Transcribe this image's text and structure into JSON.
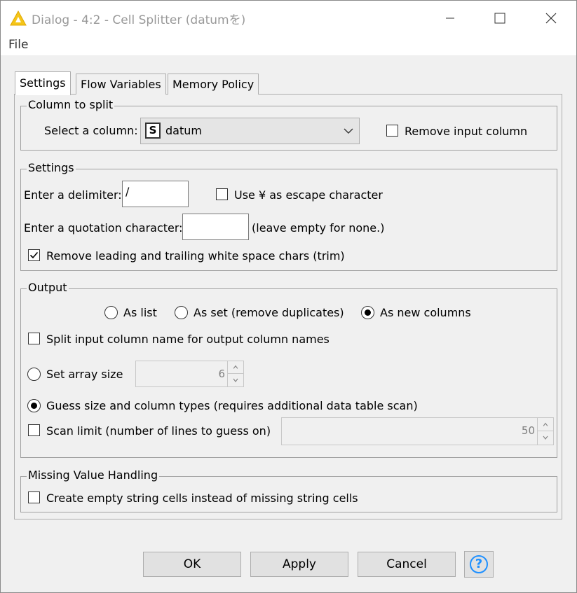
{
  "window": {
    "title": "Dialog - 4:2 - Cell Splitter (datumを)",
    "menu_file": "File"
  },
  "tabs": [
    "Settings",
    "Flow Variables",
    "Memory Policy"
  ],
  "column_group": {
    "title": "Column to split",
    "select_label": "Select a column:",
    "selected_type_icon": "S",
    "selected_column": "datum",
    "remove_input_label": "Remove input column",
    "remove_input_checked": false
  },
  "settings_group": {
    "title": "Settings",
    "delimiter_label": "Enter a delimiter:",
    "delimiter_value": "/",
    "escape_label": "Use ¥ as escape character",
    "escape_checked": false,
    "quote_label": "Enter a quotation character:",
    "quote_value": "",
    "quote_hint": "(leave empty for none.)",
    "trim_label": "Remove leading and trailing white space chars (trim)",
    "trim_checked": true
  },
  "output_group": {
    "title": "Output",
    "as_list_label": "As list",
    "as_set_label": "As set (remove duplicates)",
    "as_columns_label": "As new columns",
    "selected_output": "As new columns",
    "split_names_label": "Split input column name for output column names",
    "split_names_checked": false,
    "array_size_label": "Set array size",
    "array_size_value": "6",
    "guess_label": "Guess size and column types (requires additional data table scan)",
    "guess_selected": true,
    "scan_limit_label": "Scan limit (number of lines to guess on)",
    "scan_limit_checked": false,
    "scan_limit_value": "50"
  },
  "missing_group": {
    "title": "Missing Value Handling",
    "empty_string_label": "Create empty string cells instead of missing string cells",
    "empty_string_checked": false
  },
  "buttons": {
    "ok": "OK",
    "apply": "Apply",
    "cancel": "Cancel",
    "help_icon": "?"
  },
  "colors": {
    "title_icon": "#f5c518",
    "help_icon": "#1e90ff"
  }
}
